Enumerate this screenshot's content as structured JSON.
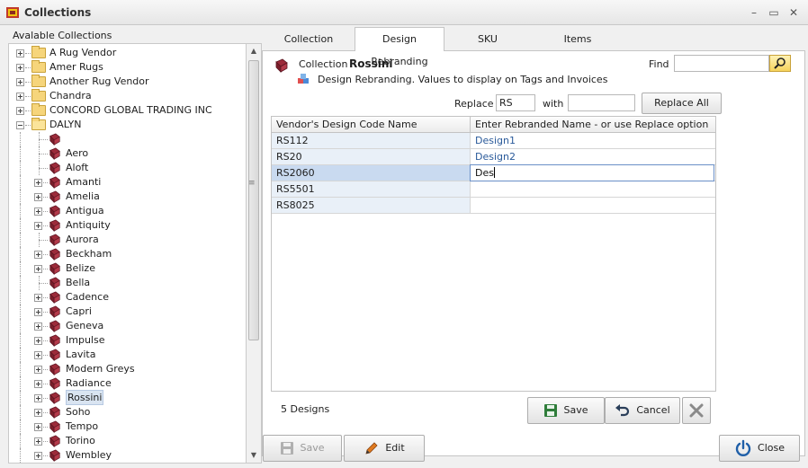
{
  "window": {
    "title": "Collections",
    "controls": [
      "–",
      "▭",
      "✕"
    ]
  },
  "sidebar": {
    "header": "Avalable Collections",
    "folders": [
      "A Rug Vendor",
      "Amer Rugs",
      "Another Rug Vendor",
      "Chandra",
      "CONCORD GLOBAL TRADING INC",
      "DALYN"
    ],
    "collections": [
      {
        "label": "",
        "expandable": false
      },
      {
        "label": "Aero",
        "expandable": false
      },
      {
        "label": "Aloft",
        "expandable": false
      },
      {
        "label": "Amanti",
        "expandable": true
      },
      {
        "label": "Amelia",
        "expandable": true
      },
      {
        "label": "Antigua",
        "expandable": true
      },
      {
        "label": "Antiquity",
        "expandable": true
      },
      {
        "label": "Aurora",
        "expandable": false
      },
      {
        "label": "Beckham",
        "expandable": true
      },
      {
        "label": "Belize",
        "expandable": true
      },
      {
        "label": "Bella",
        "expandable": false
      },
      {
        "label": "Cadence",
        "expandable": true
      },
      {
        "label": "Capri",
        "expandable": true
      },
      {
        "label": "Geneva",
        "expandable": true
      },
      {
        "label": "Impulse",
        "expandable": true
      },
      {
        "label": "Lavita",
        "expandable": true
      },
      {
        "label": "Modern Greys",
        "expandable": true
      },
      {
        "label": "Radiance",
        "expandable": true
      },
      {
        "label": "Rossini",
        "expandable": true,
        "selected": true
      },
      {
        "label": "Soho",
        "expandable": true
      },
      {
        "label": "Tempo",
        "expandable": true
      },
      {
        "label": "Torino",
        "expandable": true
      },
      {
        "label": "Wembley",
        "expandable": true
      }
    ]
  },
  "tabs": [
    {
      "label": "Collection",
      "active": false
    },
    {
      "label": "Design Rebranding",
      "active": true
    },
    {
      "label": "SKU",
      "active": false
    },
    {
      "label": "Items",
      "active": false
    }
  ],
  "collection": {
    "label": "Collection",
    "name": "Rossini",
    "find_label": "Find",
    "find_value": "",
    "subtitle": "Design Rebranding. Values to display on Tags and Invoices"
  },
  "replace": {
    "label": "Replace",
    "value": "RS",
    "with_label": "with",
    "with_value": "",
    "button": "Replace All"
  },
  "grid": {
    "columns": [
      "Vendor's Design Code Name",
      "Enter Rebranded Name - or use Replace option"
    ],
    "rows": [
      {
        "code": "RS112",
        "name": "Design1"
      },
      {
        "code": "RS20",
        "name": "Design2"
      },
      {
        "code": "RS2060",
        "name": "Des",
        "editing": true
      },
      {
        "code": "RS5501",
        "name": ""
      },
      {
        "code": "RS8025",
        "name": ""
      }
    ]
  },
  "footer": {
    "count": "5 Designs",
    "save": "Save",
    "cancel": "Cancel"
  },
  "bottom": {
    "save": "Save",
    "edit": "Edit",
    "close": "Close"
  },
  "colors": {
    "accent": "#2a5a9a",
    "selection": "#c9daf0",
    "book": "#7a1f2b"
  }
}
